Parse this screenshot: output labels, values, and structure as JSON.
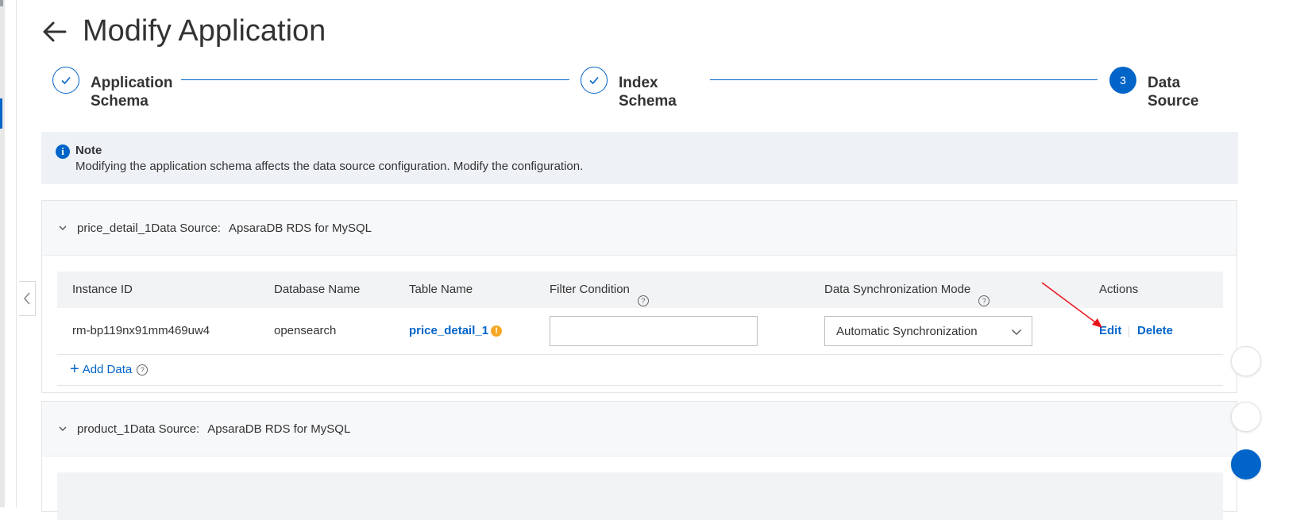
{
  "page": {
    "title": "Modify Application"
  },
  "steps": [
    {
      "line1": "Application",
      "line2": "Schema",
      "status": "done"
    },
    {
      "line1": "Index",
      "line2": "Schema",
      "status": "done"
    },
    {
      "number": "3",
      "line1": "Data",
      "line2": "Source",
      "status": "active"
    }
  ],
  "note": {
    "icon": "info-icon",
    "title": "Note",
    "text": "Modifying the application schema affects the data source configuration. Modify the configuration."
  },
  "table_columns": {
    "instance_id": "Instance ID",
    "database_name": "Database Name",
    "table_name": "Table Name",
    "filter_condition": "Filter Condition",
    "sync_mode": "Data Synchronization Mode",
    "actions": "Actions"
  },
  "data_sources": [
    {
      "name": "price_detail_1",
      "source_label": "Data Source:",
      "source_value": "ApsaraDB RDS for MySQL",
      "expanded": true,
      "rows": [
        {
          "instance_id": "rm-bp119nx91mm469uw4",
          "database_name": "opensearch",
          "table_name": "price_detail_1",
          "filter_condition": "",
          "sync_mode": "Automatic Synchronization",
          "edit_label": "Edit",
          "delete_label": "Delete"
        }
      ],
      "add_data_label": "Add Data"
    },
    {
      "name": "product_1",
      "source_label": "Data Source:",
      "source_value": "ApsaraDB RDS for MySQL",
      "expanded": true
    }
  ],
  "colors": {
    "accent": "#0064c8",
    "warning": "#f5a623",
    "annotation_arrow": "#e8141b"
  }
}
